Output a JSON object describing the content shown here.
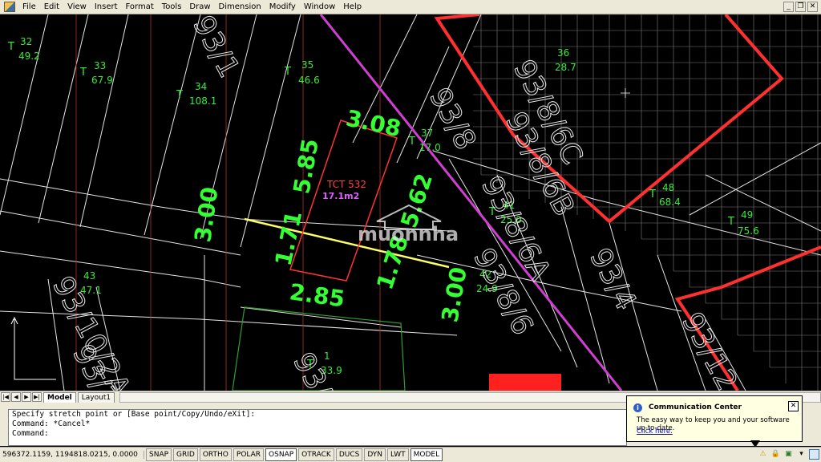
{
  "menu": {
    "items": [
      "File",
      "Edit",
      "View",
      "Insert",
      "Format",
      "Tools",
      "Draw",
      "Dimension",
      "Modify",
      "Window",
      "Help"
    ]
  },
  "window_controls": {
    "minimize": "_",
    "restore": "❐",
    "close": "✕"
  },
  "drawing": {
    "parcel_labels": [
      {
        "id": "t32",
        "prefix": "T",
        "num": "32",
        "area": "49.2"
      },
      {
        "id": "t33",
        "prefix": "T",
        "num": "33",
        "area": "67.9"
      },
      {
        "id": "t34",
        "prefix": "T",
        "num": "34",
        "area": "108.1"
      },
      {
        "id": "t35",
        "prefix": "T",
        "num": "35",
        "area": "46.6"
      },
      {
        "id": "t37",
        "prefix": "T",
        "num": "37",
        "area": "17.0"
      },
      {
        "id": "t41",
        "prefix": "T",
        "num": "41",
        "area": "25.0"
      },
      {
        "id": "t48",
        "prefix": "T",
        "num": "48",
        "area": "68.4"
      },
      {
        "id": "t49",
        "prefix": "T",
        "num": "49",
        "area": "75.6"
      },
      {
        "id": "t42",
        "prefix": "T",
        "num": "42",
        "area": "24.9"
      },
      {
        "id": "t43",
        "prefix": "T",
        "num": "43",
        "area": "47.1"
      },
      {
        "id": "t1",
        "prefix": "T",
        "num": "1",
        "area": "33.9"
      },
      {
        "id": "t36",
        "prefix": "T",
        "num": "36",
        "area": "28.7"
      }
    ],
    "house_numbers": [
      "93/8/6C",
      "93/8/6B",
      "93/8/6A",
      "93/8/6",
      "93/10/2A",
      "93/10/2B",
      "93/10/2",
      "93/4",
      "93/12",
      "93/8",
      "93/1"
    ],
    "dimensions": [
      "3.08",
      "5.85",
      "3.00",
      "1.71",
      "5.62",
      "1.78",
      "2.85",
      "3.00"
    ],
    "parcel_tag": "TCT 532",
    "parcel_area": "17.1m2",
    "watermark": "muonnha",
    "colors": {
      "dimension": "#33ff33",
      "boundary": "#ff3333",
      "road": "#d040d0",
      "line": "#e6e6e6",
      "grid": "#8a8a8a",
      "highlight": "#ffff66"
    }
  },
  "tabs": {
    "model": "Model",
    "layout1": "Layout1",
    "nav": [
      "|◀",
      "◀",
      "▶",
      "▶|"
    ]
  },
  "command": {
    "line1": "Specify stretch point or [Base point/Copy/Undo/eXit]:",
    "line2": "Command: *Cancel*",
    "line3": "Command:"
  },
  "status": {
    "coords": "596372.1159, 1194818.0215, 0.0000",
    "buttons": [
      "SNAP",
      "GRID",
      "ORTHO",
      "POLAR",
      "OSNAP",
      "OTRACK",
      "DUCS",
      "DYN",
      "LWT",
      "MODEL"
    ]
  },
  "popup": {
    "title": "Communication Center",
    "message": "The easy way to keep you and your software up-to-date.",
    "link": "Click here."
  }
}
